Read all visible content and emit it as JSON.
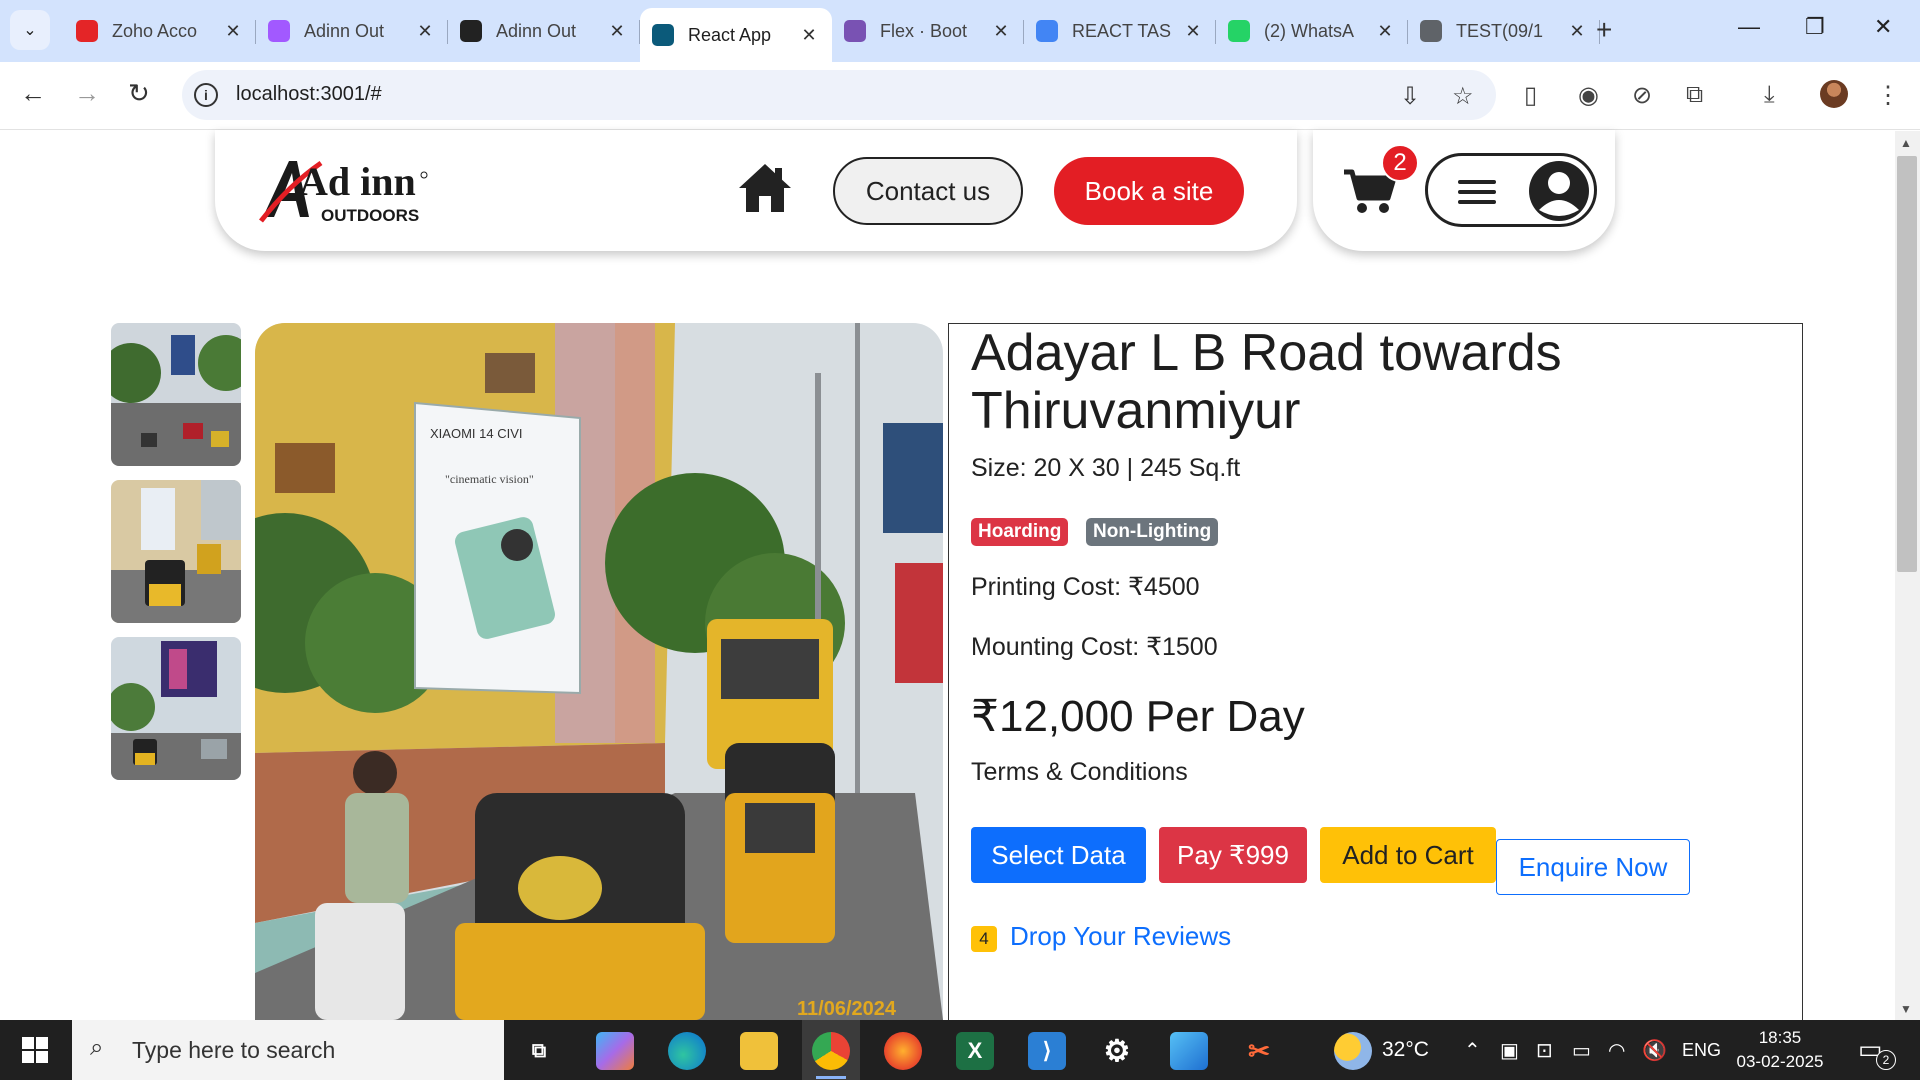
{
  "browser": {
    "tabs": [
      {
        "label": "Zoho Acco",
        "favicon": "zoho-icon",
        "color": "#e42527"
      },
      {
        "label": "Adinn Out",
        "favicon": "figma-icon",
        "color": "#a259ff"
      },
      {
        "label": "Adinn Out",
        "favicon": "play-icon",
        "color": "#222222"
      },
      {
        "label": "React App",
        "favicon": "react-icon",
        "color": "#0b5a7a"
      },
      {
        "label": "Flex · Boot",
        "favicon": "bootstrap-icon",
        "color": "#7952b3"
      },
      {
        "label": "REACT TAS",
        "favicon": "docs-icon",
        "color": "#4285f4"
      },
      {
        "label": "(2) WhatsA",
        "favicon": "whatsapp-icon",
        "color": "#25d366"
      },
      {
        "label": "TEST(09/1",
        "favicon": "globe-icon",
        "color": "#5f6368"
      }
    ],
    "active_tab_index": 3,
    "url": "localhost:3001/#"
  },
  "header": {
    "logo_text": "Ad inn",
    "logo_sub": "OUTDOORS",
    "contact_label": "Contact us",
    "book_label": "Book a site",
    "cart_count": "2"
  },
  "site": {
    "title": "Adayar L B Road towards Thiruvanmiyur",
    "size": "Size: 20 X 30 | 245 Sq.ft",
    "tags": [
      "Hoarding",
      "Non-Lighting"
    ],
    "printing_cost": "Printing Cost: ₹4500",
    "mounting_cost": "Mounting Cost: ₹1500",
    "price": "₹12,000 Per Day",
    "terms": "Terms & Conditions",
    "actions": {
      "select": "Select Data",
      "pay": "Pay ₹999",
      "cart": "Add to Cart",
      "enquire": "Enquire Now"
    },
    "review_count": "4",
    "review_link": "Drop Your Reviews",
    "billboard_brand": "XIAOMI 14 CIVI",
    "billboard_tagline": "\"cinematic vision\"",
    "photo_date": "11/06/2024"
  },
  "taskbar": {
    "search_placeholder": "Type here to search",
    "temperature": "32°C",
    "language": "ENG",
    "time": "18:35",
    "date": "03-02-2025",
    "notification_count": "2"
  },
  "colors": {
    "brand_red": "#e31e24",
    "primary": "#0d6efd",
    "danger": "#dc3545",
    "warning": "#ffc107",
    "secondary": "#6c757d"
  }
}
